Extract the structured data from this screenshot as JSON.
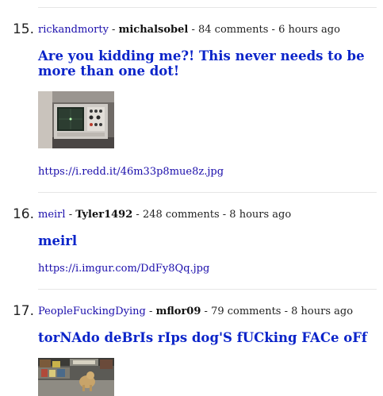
{
  "posts": [
    {
      "rank": "15.",
      "subreddit": "rickandmorty",
      "sep1": " - ",
      "author": "michalsobel",
      "sep2": " - ",
      "comments": "84 comments",
      "sep3": " - ",
      "time": "6 hours ago",
      "title": "Are you kidding me?! This never needs to be more than one dot!",
      "url": "https://i.redd.it/46m33p8mue8z.jpg"
    },
    {
      "rank": "16.",
      "subreddit": "meirl",
      "sep1": " - ",
      "author": "Tyler1492",
      "sep2": " - ",
      "comments": "248 comments",
      "sep3": " - ",
      "time": "8 hours ago",
      "title": "meirl",
      "url": "https://i.imgur.com/DdFy8Qq.jpg"
    },
    {
      "rank": "17.",
      "subreddit": "PeopleFuckingDying",
      "sep1": " - ",
      "author": "mflor09",
      "sep2": " - ",
      "comments": "79 comments",
      "sep3": " - ",
      "time": "8 hours ago",
      "title": "torNAdo deBrIs rIps dog'S fUCking FACe oFf"
    }
  ]
}
